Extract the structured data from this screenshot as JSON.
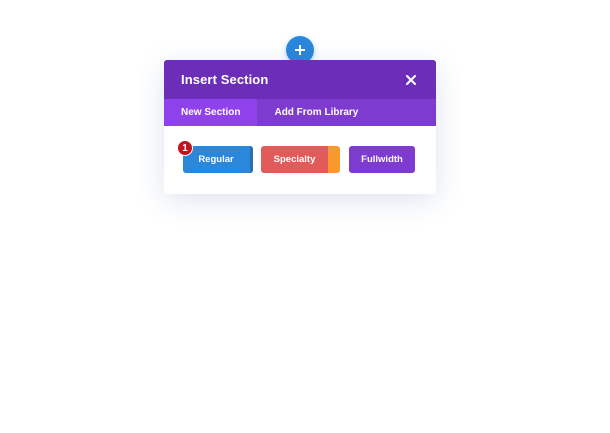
{
  "add_button": {
    "icon": "plus-icon",
    "color": "#2b87da"
  },
  "modal": {
    "title": "Insert Section",
    "close_icon": "close-icon",
    "colors": {
      "header": "#6c2eb9",
      "tabs_bar": "#7e3bd0",
      "active_tab": "#8f42ec"
    }
  },
  "tabs": [
    {
      "label": "New Section",
      "active": true
    },
    {
      "label": "Add From Library",
      "active": false
    }
  ],
  "section_types": [
    {
      "label": "Regular",
      "color": "#2b87da"
    },
    {
      "label": "Specialty",
      "color": "#e25b5b",
      "accent": "#f59a2b"
    },
    {
      "label": "Fullwidth",
      "color": "#7e3bd0"
    }
  ],
  "annotation": {
    "badge": "1",
    "color": "#c1121f"
  }
}
